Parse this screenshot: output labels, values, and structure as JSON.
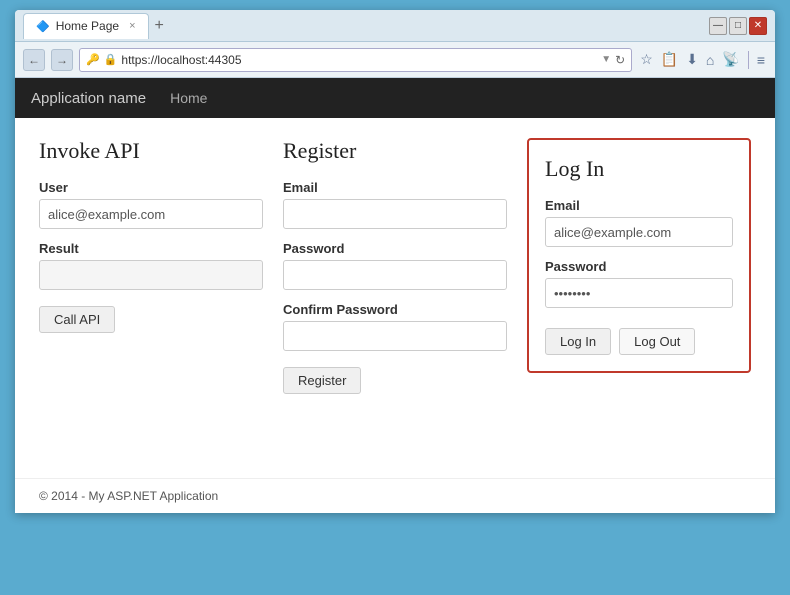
{
  "browser": {
    "tab_label": "Home Page",
    "tab_close": "×",
    "tab_new": "+",
    "window_minimize": "—",
    "window_maximize": "□",
    "window_close": "✕",
    "nav_back": "←",
    "nav_forward": "→",
    "url_lock": "🔒",
    "url": "https://localhost:44305",
    "url_dropdown": "▼",
    "url_refresh": "↻",
    "toolbar_star": "☆",
    "toolbar_clipboard": "📋",
    "toolbar_download": "⬇",
    "toolbar_home": "⌂",
    "toolbar_feed": "📡",
    "toolbar_menu": "≡"
  },
  "navbar": {
    "brand": "Application name",
    "home_link": "Home"
  },
  "invoke_api": {
    "title": "Invoke API",
    "user_label": "User",
    "user_placeholder": "alice@example.com",
    "user_value": "alice@example.com",
    "result_label": "Result",
    "result_value": "",
    "call_btn": "Call API"
  },
  "register": {
    "title": "Register",
    "email_label": "Email",
    "email_value": "",
    "password_label": "Password",
    "password_value": "",
    "confirm_label": "Confirm Password",
    "confirm_value": "",
    "register_btn": "Register"
  },
  "login": {
    "title": "Log In",
    "email_label": "Email",
    "email_value": "alice@example.com",
    "password_label": "Password",
    "password_value": "••••••••",
    "login_btn": "Log In",
    "logout_btn": "Log Out"
  },
  "footer": {
    "text": "© 2014 - My ASP.NET Application"
  }
}
